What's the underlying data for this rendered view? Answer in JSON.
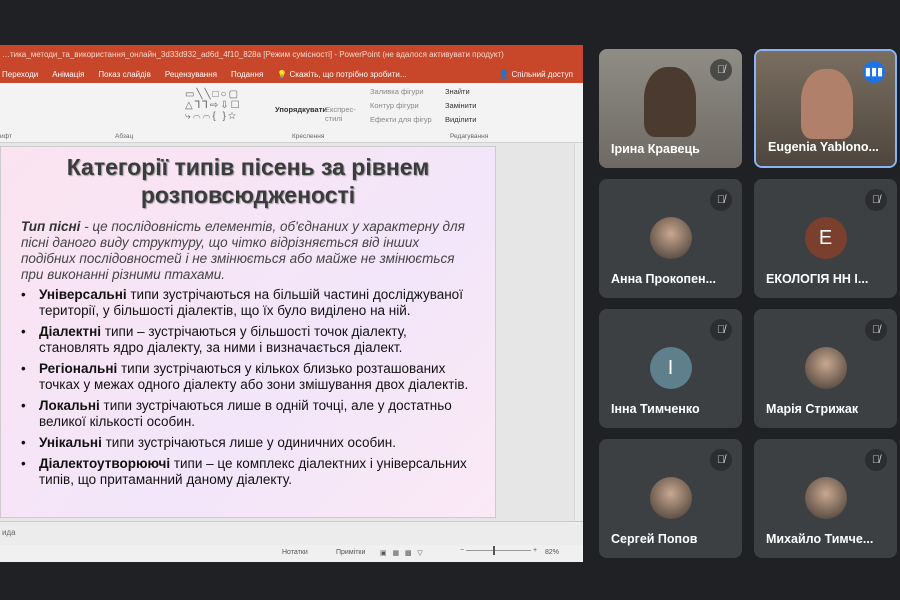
{
  "ppt": {
    "title": "…тика_методи_та_використання_онлайн_3d33d932_ad6d_4f10_828a [Режим сумісності] - PowerPoint (не вдалося активувати продукт)",
    "menu": [
      "Переходи",
      "Анімація",
      "Показ слайдів",
      "Рецензування",
      "Подання"
    ],
    "tell_me": "Скажіть, що потрібно зробити...",
    "share": "Спільний доступ",
    "ribbon": {
      "arrange": "Упорядкувати",
      "quick_styles": "Експрес-стилі",
      "shape_fill": "Заливка фігури",
      "shape_outline": "Контур фігури",
      "shape_effects": "Ефекти для фігур",
      "find": "Знайти",
      "replace": "Замінити",
      "select": "Виділити",
      "groups": {
        "font": "ифт",
        "paragraph": "Абзац",
        "drawing": "Креслення",
        "editing": "Редагування"
      }
    },
    "slide": {
      "title": "Категорії типів пісень за рівнем розповсюдженості",
      "definition_term": "Тип пісні",
      "definition_text": " - це послідовність елементів, об'єднаних у характерну для пісні даного виду структуру, що чітко відрізняється від інших подібних послідовностей і не змінюється або майже не змінюється при виконанні різними птахами.",
      "bullets": [
        {
          "term": "Універсальні",
          "text": " типи зустрічаються на більшій частині досліджуваної території, у більшості діалектів, що їх було виділено на ній."
        },
        {
          "term": "Діалектні",
          "text": " типи – зустрічаються у більшості точок діалекту, становлять ядро діалекту, за ними і визначається діалект."
        },
        {
          "term": "Регіональні",
          "text": " типи зустрічаються у кількох близько розташованих точках у межах одного діалекту або зони змішування двох діалектів."
        },
        {
          "term": "Локальні",
          "text": " типи зустрічаються лише в одній точці, але у достатньо великої кількості особин."
        },
        {
          "term": "Унікальні",
          "text": " типи зустрічаються лише у одиничних особин."
        },
        {
          "term": "Діалектоутворюючі",
          "text": " типи – це комплекс діалектних і універсальних типів, що притаманний даному діалекту."
        }
      ]
    },
    "notes_placeholder": "ида",
    "status": {
      "notes": "Нотатки",
      "comments": "Примітки",
      "zoom": "82%",
      "zoom_level": 0.41
    }
  },
  "participants": [
    {
      "name": "Ірина Кравець",
      "muted": true,
      "video": true
    },
    {
      "name": "Eugenia Yablono...",
      "muted": false,
      "speaking": true,
      "video": true
    },
    {
      "name": "Анна Прокопен...",
      "muted": true,
      "avatar": "photo"
    },
    {
      "name": "ЕКОЛОГІЯ НН І...",
      "muted": true,
      "avatar": "E",
      "avatar_color": "#7b3f2d"
    },
    {
      "name": "Інна Тимченко",
      "muted": true,
      "avatar": "I",
      "avatar_color": "#5f7f8c"
    },
    {
      "name": "Марія Стрижак",
      "muted": true,
      "avatar": "photo"
    },
    {
      "name": "Сергей Попов",
      "muted": true,
      "avatar": "photo"
    },
    {
      "name": "Михайло Тимче...",
      "muted": true,
      "avatar": "photo"
    }
  ]
}
